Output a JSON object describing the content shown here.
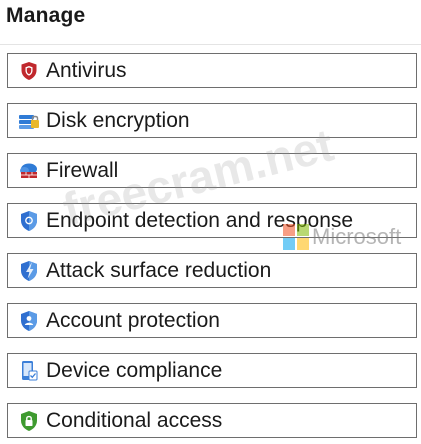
{
  "section": {
    "title": "Manage"
  },
  "items": [
    {
      "label": "Antivirus",
      "icon": "shield-icon",
      "icon_color": "#c0282d"
    },
    {
      "label": "Disk encryption",
      "icon": "disk-encryption-icon",
      "icon_color": "#2f7bd6"
    },
    {
      "label": "Firewall",
      "icon": "firewall-icon",
      "icon_color": "#c0282d"
    },
    {
      "label": "Endpoint detection and response",
      "icon": "endpoint-detection-icon",
      "icon_color": "#2f6fd0"
    },
    {
      "label": "Attack surface reduction",
      "icon": "attack-surface-icon",
      "icon_color": "#2f6fd0"
    },
    {
      "label": "Account protection",
      "icon": "account-protection-icon",
      "icon_color": "#2f6fd0"
    },
    {
      "label": "Device compliance",
      "icon": "device-compliance-icon",
      "icon_color": "#3b7fd8"
    },
    {
      "label": "Conditional access",
      "icon": "conditional-access-icon",
      "icon_color": "#3e9a2f"
    }
  ],
  "watermark": {
    "text": "freecram.net",
    "brand": "Microsoft"
  }
}
